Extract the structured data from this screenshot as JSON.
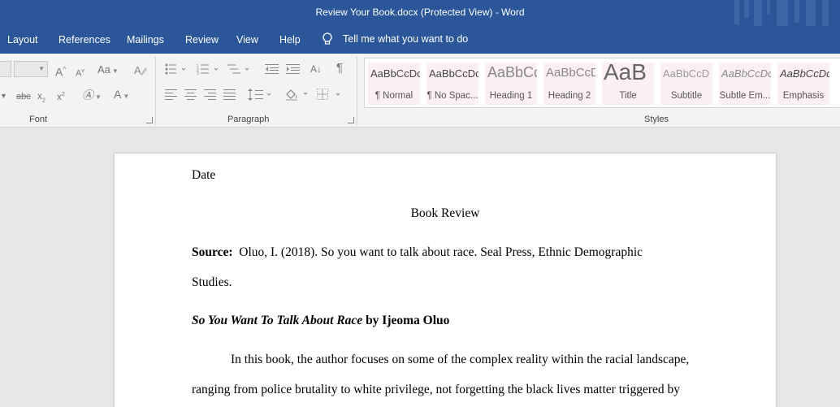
{
  "titlebar": {
    "title": "Review Your Book.docx (Protected View)  -  Word"
  },
  "menu": {
    "tabs": [
      "Layout",
      "References",
      "Mailings",
      "Review",
      "View",
      "Help"
    ],
    "tell_me": "Tell me what you want to do"
  },
  "ribbon": {
    "groups": {
      "font": "Font",
      "paragraph": "Paragraph",
      "styles": "Styles"
    },
    "font_tools": {
      "grow": "A",
      "shrink": "A",
      "change_case": "Aa",
      "strikethrough": "abc",
      "subscript": "x",
      "superscript": "x",
      "font_color": "A"
    },
    "paragraph_tools": {
      "sort": "A↓",
      "pilcrow": "¶"
    },
    "styles": [
      {
        "sample": "AaBbCcDc",
        "name": "¶ Normal"
      },
      {
        "sample": "AaBbCcDc",
        "name": "¶ No Spac..."
      },
      {
        "sample": "AaBbCc",
        "name": "Heading 1"
      },
      {
        "sample": "AaBbCcD",
        "name": "Heading 2"
      },
      {
        "sample": "AaB",
        "name": "Title"
      },
      {
        "sample": "AaBbCcD",
        "name": "Subtitle"
      },
      {
        "sample": "AaBbCcDc",
        "name": "Subtle Em..."
      },
      {
        "sample": "AaBbCcDc",
        "name": "Emphasis"
      }
    ]
  },
  "document": {
    "date": "Date",
    "heading": "Book Review",
    "source_label": "Source:",
    "source_text": "Oluo, I. (2018). So you want to talk about race. Seal Press, Ethnic Demographic",
    "source_cont": "Studies.",
    "book_title": "So You Want To Talk About Race",
    "book_by": " by Ijeoma Oluo",
    "para1_line1": "In this book, the author focuses on some of the complex reality within the racial landscape,",
    "para1_line2": "ranging from police brutality to white privilege, not forgetting the black lives matter triggered by"
  }
}
